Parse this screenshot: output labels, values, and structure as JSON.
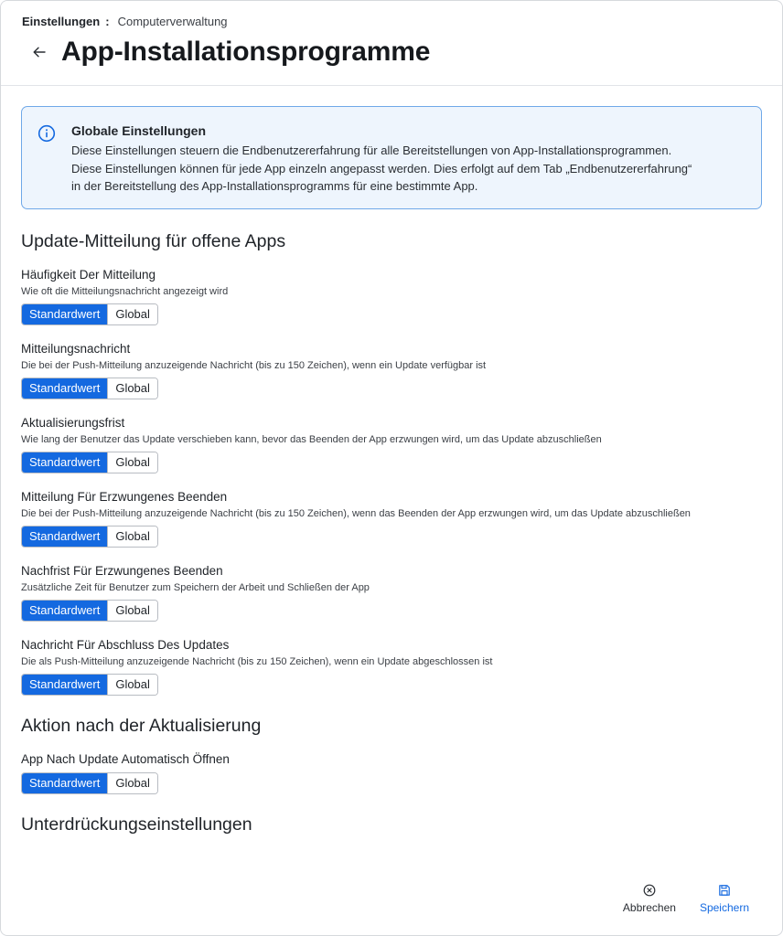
{
  "breadcrumb": {
    "root": "Einstellungen",
    "separator": ":",
    "current": "Computerverwaltung"
  },
  "page": {
    "title": "App-Installationsprogramme"
  },
  "info": {
    "title": "Globale Einstellungen",
    "lines": [
      "Diese Einstellungen steuern die Endbenutzererfahrung für alle Bereitstellungen von App-Installationsprogrammen.",
      "Diese Einstellungen können für jede App einzeln angepasst werden. Dies erfolgt auf dem Tab „Endbenutzererfahrung“",
      "in der Bereitstellung des App-Installationsprogramms für eine bestimmte App."
    ]
  },
  "sections": [
    {
      "title": "Update-Mitteilung für offene Apps",
      "settings": [
        {
          "label": "Häufigkeit Der Mitteilung",
          "desc": "Wie oft die Mitteilungsnachricht angezeigt wird"
        },
        {
          "label": "Mitteilungsnachricht",
          "desc": "Die bei der Push-Mitteilung anzuzeigende Nachricht (bis zu 150 Zeichen), wenn ein Update verfügbar ist"
        },
        {
          "label": "Aktualisierungsfrist",
          "desc": "Wie lang der Benutzer das Update verschieben kann, bevor das Beenden der App erzwungen wird, um das Update abzuschließen"
        },
        {
          "label": "Mitteilung Für Erzwungenes Beenden",
          "desc": "Die bei der Push-Mitteilung anzuzeigende Nachricht (bis zu 150 Zeichen), wenn das Beenden der App erzwungen wird, um das Update abzuschließen"
        },
        {
          "label": "Nachfrist Für Erzwungenes Beenden",
          "desc": "Zusätzliche Zeit für Benutzer zum Speichern der Arbeit und Schließen der App"
        },
        {
          "label": "Nachricht Für Abschluss Des Updates",
          "desc": "Die als Push-Mitteilung anzuzeigende Nachricht (bis zu 150 Zeichen), wenn ein Update abgeschlossen ist"
        }
      ]
    },
    {
      "title": "Aktion nach der Aktualisierung",
      "settings": [
        {
          "label": "App Nach Update Automatisch Öffnen",
          "desc": ""
        }
      ]
    },
    {
      "title": "Unterdrückungseinstellungen",
      "settings": []
    }
  ],
  "toggle": {
    "option_default": "Standardwert",
    "option_global": "Global",
    "selected": "Standardwert"
  },
  "footer": {
    "cancel_label": "Abbrechen",
    "save_label": "Speichern"
  },
  "colors": {
    "accent": "#1469e0",
    "info_border": "#6fa8e8",
    "info_bg": "#eef5fd"
  },
  "icons": {
    "back": "arrow-left-icon",
    "info": "info-circle-icon",
    "cancel": "x-circle-icon",
    "save": "floppy-disk-icon"
  }
}
